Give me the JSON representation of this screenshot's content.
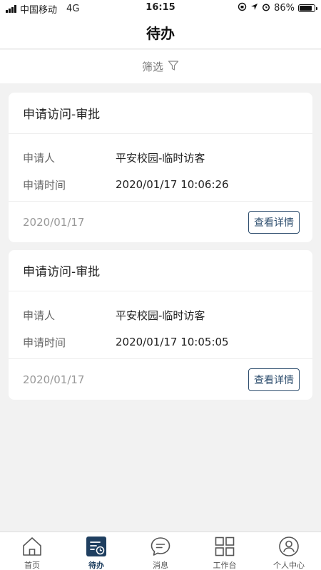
{
  "status_bar": {
    "carrier": "中国移动",
    "network": "4G",
    "time": "16:15",
    "battery": "86%",
    "battery_level": 0.86
  },
  "header": {
    "title": "待办"
  },
  "filter": {
    "label": "筛选"
  },
  "cards": [
    {
      "title": "申请访问-审批",
      "rows": [
        {
          "label": "申请人",
          "value": "平安校园-临时访客"
        },
        {
          "label": "申请时间",
          "value": "2020/01/17 10:06:26"
        }
      ],
      "date": "2020/01/17",
      "button": "查看详情"
    },
    {
      "title": "申请访问-审批",
      "rows": [
        {
          "label": "申请人",
          "value": "平安校园-临时访客"
        },
        {
          "label": "申请时间",
          "value": "2020/01/17 10:05:05"
        }
      ],
      "date": "2020/01/17",
      "button": "查看详情"
    }
  ],
  "tabbar": {
    "items": [
      {
        "label": "首页",
        "icon": "home-icon"
      },
      {
        "label": "待办",
        "icon": "todo-icon",
        "active": true
      },
      {
        "label": "消息",
        "icon": "message-icon"
      },
      {
        "label": "工作台",
        "icon": "grid-icon"
      },
      {
        "label": "个人中心",
        "icon": "person-icon"
      }
    ]
  },
  "colors": {
    "accent": "#1f3f60",
    "background": "#f2f2f2"
  }
}
